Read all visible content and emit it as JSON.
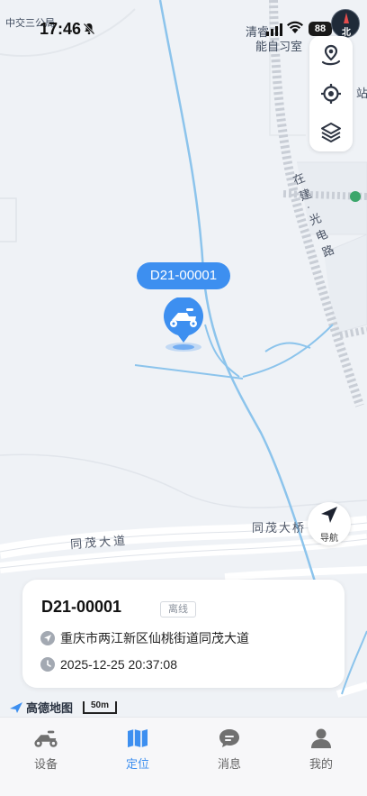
{
  "status_bar": {
    "time": "17:46",
    "battery": "88"
  },
  "compass": {
    "label": "北"
  },
  "map": {
    "labels": {
      "top_left_poi": "中交三公局",
      "top_right_poi_1": "清睿",
      "top_right_poi_2": "能自习室",
      "right_station": "站",
      "vertical_road": "在建·光电路",
      "road_main": "同茂大道",
      "bridge": "同茂大桥"
    },
    "scale": "50m",
    "provider_logo": "高德地图"
  },
  "device_tag": "D21-00001",
  "nav_button": {
    "label": "导航"
  },
  "info_card": {
    "title": "D21-00001",
    "status_badge": "离线",
    "address": "重庆市两江新区仙桃街道同茂大道",
    "time": "2025-12-25 20:37:08"
  },
  "tabs": [
    {
      "label": "设备",
      "icon": "scooter-icon"
    },
    {
      "label": "定位",
      "icon": "map-icon",
      "active": true
    },
    {
      "label": "消息",
      "icon": "message-icon"
    },
    {
      "label": "我的",
      "icon": "user-icon"
    }
  ],
  "colors": {
    "accent": "#3d8ff0",
    "river": "#8cc4ec",
    "map_bg": "#eff2f6"
  }
}
